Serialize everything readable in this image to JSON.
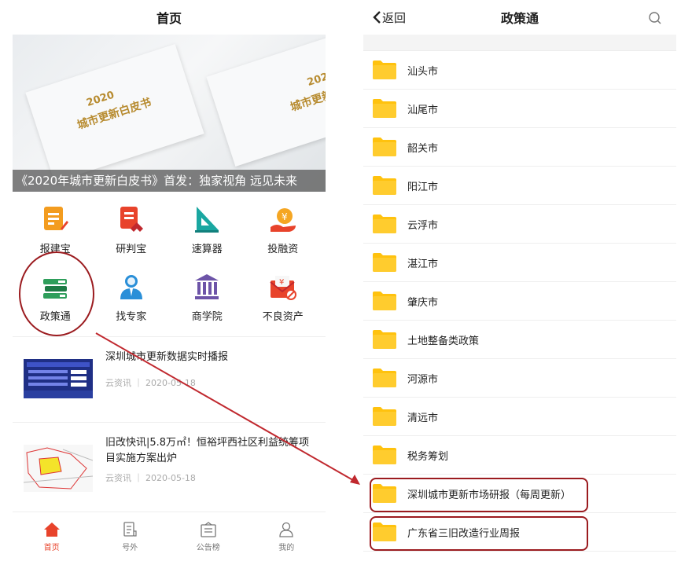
{
  "home": {
    "title": "首页",
    "banner": {
      "caption": "《2020年城市更新白皮书》首发：独家视角 远见未来",
      "year": "2020",
      "book_title": "城市更新白皮书"
    },
    "tools": [
      {
        "label": "报建宝",
        "icon": "document-pen-icon"
      },
      {
        "label": "研判宝",
        "icon": "document-analysis-icon"
      },
      {
        "label": "速算器",
        "icon": "triangle-ruler-icon"
      },
      {
        "label": "投融资",
        "icon": "money-bag-hand-icon"
      },
      {
        "label": "政策通",
        "icon": "books-stack-icon"
      },
      {
        "label": "找专家",
        "icon": "expert-person-icon"
      },
      {
        "label": "商学院",
        "icon": "institution-building-icon"
      },
      {
        "label": "不良资产",
        "icon": "yen-envelope-icon"
      }
    ],
    "news": [
      {
        "title": "深圳城市更新数据实时播报",
        "source": "云资讯",
        "date": "2020-05-18"
      },
      {
        "title": "旧改快讯|5.8万㎡！恒裕坪西社区利益统筹项目实施方案出炉",
        "source": "云资讯",
        "date": "2020-05-18"
      }
    ],
    "tabs": [
      {
        "label": "首页",
        "active": true
      },
      {
        "label": "号外"
      },
      {
        "label": "公告榜"
      },
      {
        "label": "我的"
      }
    ]
  },
  "policy": {
    "back_label": "返回",
    "title": "政策通",
    "folders": [
      "汕头市",
      "汕尾市",
      "韶关市",
      "阳江市",
      "云浮市",
      "湛江市",
      "肇庆市",
      "土地整备类政策",
      "河源市",
      "清远市",
      "税务筹划",
      "深圳城市更新市场研报（每周更新）",
      "广东省三旧改造行业周报"
    ]
  },
  "colors": {
    "accent": "#e8432b",
    "highlight": "#9b1b1f",
    "folder": "#ffc20e"
  }
}
